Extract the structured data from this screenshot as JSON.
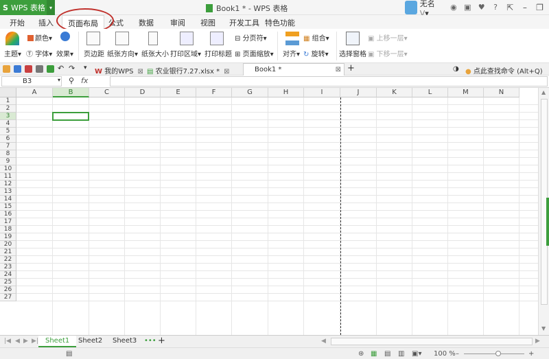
{
  "app": {
    "wps_label": "WPS 表格",
    "wps_s": "S",
    "title": "Book1 * - WPS 表格",
    "user": "无名",
    "user_level": "V"
  },
  "ribbon_tabs": [
    "开始",
    "插入",
    "页面布局",
    "公式",
    "数据",
    "审阅",
    "视图",
    "开发工具",
    "特色功能"
  ],
  "active_tab": "页面布局",
  "ribbon": {
    "theme": "主题",
    "colors": "颜色",
    "fonts": "字体",
    "effects": "效果",
    "margins": "页边距",
    "orientation": "纸张方向",
    "size": "纸张大小",
    "print_area": "打印区域",
    "print_titles": "打印标题",
    "page_break": "分页符",
    "page_scale": "页面缩放",
    "align": "对齐",
    "group": "组合",
    "rotate": "旋转",
    "selection_pane": "选择窗格",
    "bring_forward": "上移一层",
    "send_backward": "下移一层"
  },
  "doc_tabs": [
    {
      "label": "我的WPS"
    },
    {
      "label": "农业银行7.27.xlsx *"
    },
    {
      "label": "Book1 *"
    }
  ],
  "search_label": "点此查找命令 (Alt+Q)",
  "formula_bar": {
    "name_box": "B3",
    "fx": "fx",
    "value": ""
  },
  "columns": [
    "A",
    "B",
    "C",
    "D",
    "E",
    "F",
    "G",
    "H",
    "I",
    "J",
    "K",
    "L",
    "M",
    "N"
  ],
  "rows": [
    "1",
    "2",
    "3",
    "4",
    "5",
    "6",
    "7",
    "8",
    "9",
    "10",
    "11",
    "12",
    "13",
    "14",
    "15",
    "16",
    "17",
    "18",
    "19",
    "20",
    "21",
    "22",
    "23",
    "24",
    "25",
    "26",
    "27"
  ],
  "selected_cell": {
    "col": "B",
    "row": "3"
  },
  "sheets": [
    "Sheet1",
    "Sheet2",
    "Sheet3"
  ],
  "active_sheet": "Sheet1",
  "zoom": "100 %",
  "colors": {
    "accent": "#3c9e3c",
    "highlight": "#c0302b"
  }
}
